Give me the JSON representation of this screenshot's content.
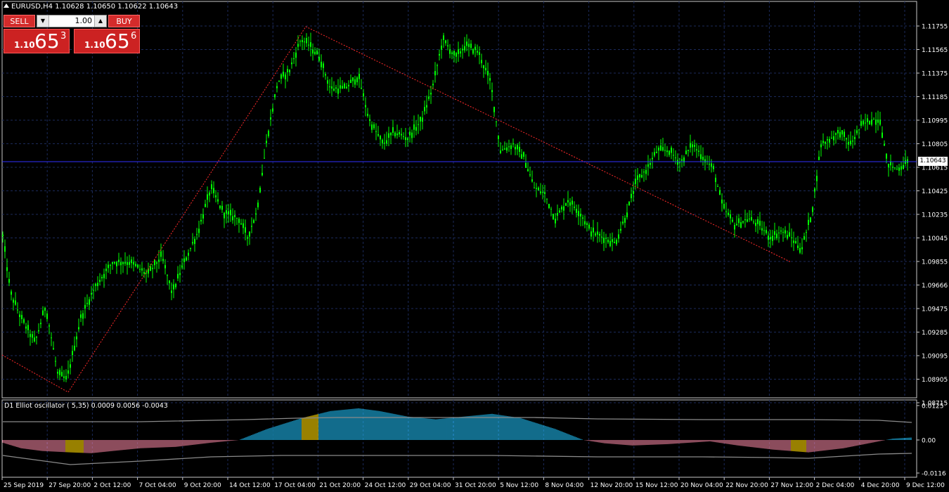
{
  "header": {
    "symbol_line": "EURUSD,H4  1.10628 1.10650 1.10622 1.10643"
  },
  "trade_panel": {
    "sell_label": "SELL",
    "buy_label": "BUY",
    "lot_value": "1.00",
    "sell_price": {
      "small": "1.10",
      "big": "65",
      "sup": "3"
    },
    "buy_price": {
      "small": "1.10",
      "big": "65",
      "sup": "6"
    }
  },
  "price_axis": {
    "labels": [
      "1.11755",
      "1.11565",
      "1.11375",
      "1.11185",
      "1.10995",
      "1.10805",
      "1.10615",
      "1.10425",
      "1.10235",
      "1.10045",
      "1.09855",
      "1.09666",
      "1.09475",
      "1.09285",
      "1.09095",
      "1.08905",
      "1.08715"
    ],
    "current_price": "1.10643"
  },
  "indicator": {
    "label": "D1 Elliot oscillator ( 5,35) 0.0009 0.0056 -0.0043",
    "axis_labels": [
      "0.0125",
      "0.00",
      "-0.0116"
    ]
  },
  "time_axis": {
    "labels": [
      "25 Sep 2019",
      "27 Sep 20:00",
      "2 Oct 12:00",
      "7 Oct 04:00",
      "9 Oct 20:00",
      "14 Oct 12:00",
      "17 Oct 04:00",
      "21 Oct 20:00",
      "24 Oct 12:00",
      "29 Oct 04:00",
      "31 Oct 20:00",
      "5 Nov 12:00",
      "8 Nov 04:00",
      "12 Nov 20:00",
      "15 Nov 12:00",
      "20 Nov 04:00",
      "22 Nov 20:00",
      "27 Nov 12:00",
      "2 Dec 04:00",
      "4 Dec 20:00",
      "9 Dec 12:00"
    ]
  },
  "colors": {
    "background": "#000000",
    "grid": "#1b2a5a",
    "candle": "#00ff00",
    "trendline": "#ff2a2a",
    "current_price_line": "#3030ff",
    "osc_positive": "#1fb4e8",
    "osc_negative": "#e87f9a",
    "osc_highlight": "#ffd700",
    "osc_line": "#8a8a8a",
    "sell_button": "#d42b2b"
  }
}
